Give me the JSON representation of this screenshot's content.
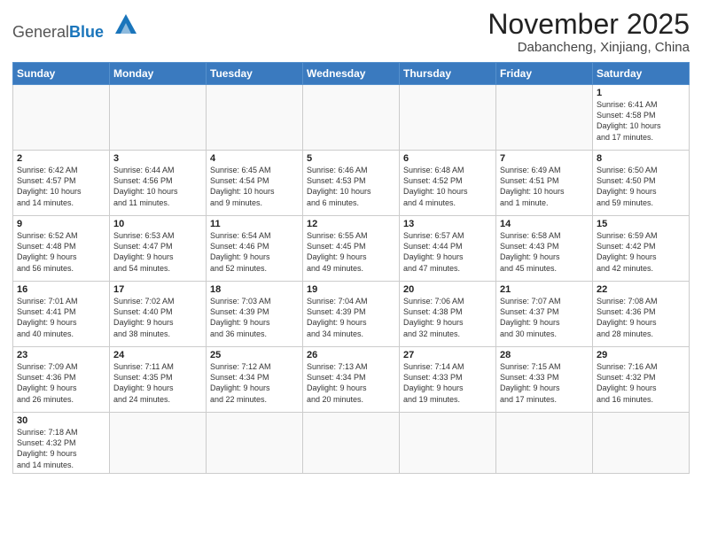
{
  "header": {
    "logo_general": "General",
    "logo_blue": "Blue",
    "month_title": "November 2025",
    "location": "Dabancheng, Xinjiang, China"
  },
  "weekdays": [
    "Sunday",
    "Monday",
    "Tuesday",
    "Wednesday",
    "Thursday",
    "Friday",
    "Saturday"
  ],
  "weeks": [
    [
      {
        "day": "",
        "info": ""
      },
      {
        "day": "",
        "info": ""
      },
      {
        "day": "",
        "info": ""
      },
      {
        "day": "",
        "info": ""
      },
      {
        "day": "",
        "info": ""
      },
      {
        "day": "",
        "info": ""
      },
      {
        "day": "1",
        "info": "Sunrise: 6:41 AM\nSunset: 4:58 PM\nDaylight: 10 hours\nand 17 minutes."
      }
    ],
    [
      {
        "day": "2",
        "info": "Sunrise: 6:42 AM\nSunset: 4:57 PM\nDaylight: 10 hours\nand 14 minutes."
      },
      {
        "day": "3",
        "info": "Sunrise: 6:44 AM\nSunset: 4:56 PM\nDaylight: 10 hours\nand 11 minutes."
      },
      {
        "day": "4",
        "info": "Sunrise: 6:45 AM\nSunset: 4:54 PM\nDaylight: 10 hours\nand 9 minutes."
      },
      {
        "day": "5",
        "info": "Sunrise: 6:46 AM\nSunset: 4:53 PM\nDaylight: 10 hours\nand 6 minutes."
      },
      {
        "day": "6",
        "info": "Sunrise: 6:48 AM\nSunset: 4:52 PM\nDaylight: 10 hours\nand 4 minutes."
      },
      {
        "day": "7",
        "info": "Sunrise: 6:49 AM\nSunset: 4:51 PM\nDaylight: 10 hours\nand 1 minute."
      },
      {
        "day": "8",
        "info": "Sunrise: 6:50 AM\nSunset: 4:50 PM\nDaylight: 9 hours\nand 59 minutes."
      }
    ],
    [
      {
        "day": "9",
        "info": "Sunrise: 6:52 AM\nSunset: 4:48 PM\nDaylight: 9 hours\nand 56 minutes."
      },
      {
        "day": "10",
        "info": "Sunrise: 6:53 AM\nSunset: 4:47 PM\nDaylight: 9 hours\nand 54 minutes."
      },
      {
        "day": "11",
        "info": "Sunrise: 6:54 AM\nSunset: 4:46 PM\nDaylight: 9 hours\nand 52 minutes."
      },
      {
        "day": "12",
        "info": "Sunrise: 6:55 AM\nSunset: 4:45 PM\nDaylight: 9 hours\nand 49 minutes."
      },
      {
        "day": "13",
        "info": "Sunrise: 6:57 AM\nSunset: 4:44 PM\nDaylight: 9 hours\nand 47 minutes."
      },
      {
        "day": "14",
        "info": "Sunrise: 6:58 AM\nSunset: 4:43 PM\nDaylight: 9 hours\nand 45 minutes."
      },
      {
        "day": "15",
        "info": "Sunrise: 6:59 AM\nSunset: 4:42 PM\nDaylight: 9 hours\nand 42 minutes."
      }
    ],
    [
      {
        "day": "16",
        "info": "Sunrise: 7:01 AM\nSunset: 4:41 PM\nDaylight: 9 hours\nand 40 minutes."
      },
      {
        "day": "17",
        "info": "Sunrise: 7:02 AM\nSunset: 4:40 PM\nDaylight: 9 hours\nand 38 minutes."
      },
      {
        "day": "18",
        "info": "Sunrise: 7:03 AM\nSunset: 4:39 PM\nDaylight: 9 hours\nand 36 minutes."
      },
      {
        "day": "19",
        "info": "Sunrise: 7:04 AM\nSunset: 4:39 PM\nDaylight: 9 hours\nand 34 minutes."
      },
      {
        "day": "20",
        "info": "Sunrise: 7:06 AM\nSunset: 4:38 PM\nDaylight: 9 hours\nand 32 minutes."
      },
      {
        "day": "21",
        "info": "Sunrise: 7:07 AM\nSunset: 4:37 PM\nDaylight: 9 hours\nand 30 minutes."
      },
      {
        "day": "22",
        "info": "Sunrise: 7:08 AM\nSunset: 4:36 PM\nDaylight: 9 hours\nand 28 minutes."
      }
    ],
    [
      {
        "day": "23",
        "info": "Sunrise: 7:09 AM\nSunset: 4:36 PM\nDaylight: 9 hours\nand 26 minutes."
      },
      {
        "day": "24",
        "info": "Sunrise: 7:11 AM\nSunset: 4:35 PM\nDaylight: 9 hours\nand 24 minutes."
      },
      {
        "day": "25",
        "info": "Sunrise: 7:12 AM\nSunset: 4:34 PM\nDaylight: 9 hours\nand 22 minutes."
      },
      {
        "day": "26",
        "info": "Sunrise: 7:13 AM\nSunset: 4:34 PM\nDaylight: 9 hours\nand 20 minutes."
      },
      {
        "day": "27",
        "info": "Sunrise: 7:14 AM\nSunset: 4:33 PM\nDaylight: 9 hours\nand 19 minutes."
      },
      {
        "day": "28",
        "info": "Sunrise: 7:15 AM\nSunset: 4:33 PM\nDaylight: 9 hours\nand 17 minutes."
      },
      {
        "day": "29",
        "info": "Sunrise: 7:16 AM\nSunset: 4:32 PM\nDaylight: 9 hours\nand 16 minutes."
      }
    ],
    [
      {
        "day": "30",
        "info": "Sunrise: 7:18 AM\nSunset: 4:32 PM\nDaylight: 9 hours\nand 14 minutes."
      },
      {
        "day": "",
        "info": ""
      },
      {
        "day": "",
        "info": ""
      },
      {
        "day": "",
        "info": ""
      },
      {
        "day": "",
        "info": ""
      },
      {
        "day": "",
        "info": ""
      },
      {
        "day": "",
        "info": ""
      }
    ]
  ]
}
